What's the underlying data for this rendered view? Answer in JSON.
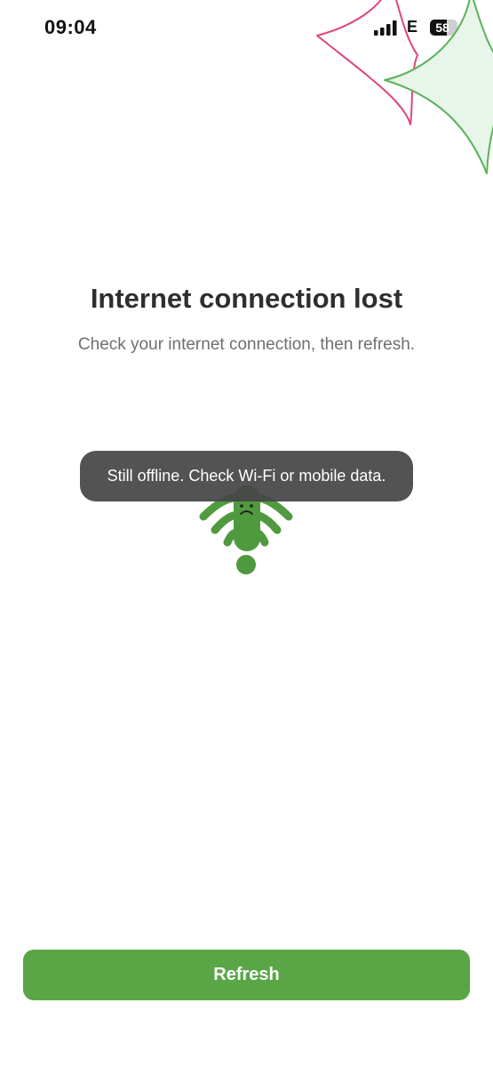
{
  "status_bar": {
    "time": "09:04",
    "network_type": "E",
    "battery_level": "58",
    "icons": [
      "signal-bars-icon",
      "battery-icon"
    ]
  },
  "main": {
    "title": "Internet connection lost",
    "subtitle": "Check your internet connection, then refresh.",
    "illustration": "sad-wifi-exclamation-icon"
  },
  "toast": {
    "message": "Still offline. Check Wi-Fi or mobile data."
  },
  "footer": {
    "refresh_label": "Refresh"
  },
  "colors": {
    "accent_green": "#5aa647",
    "illustration_green": "#4f9a3f",
    "decoration_pink": "#e0457a",
    "decoration_green": "#5cb15a",
    "decoration_fill": "#e8f6ea",
    "toast_background": "#464646"
  }
}
